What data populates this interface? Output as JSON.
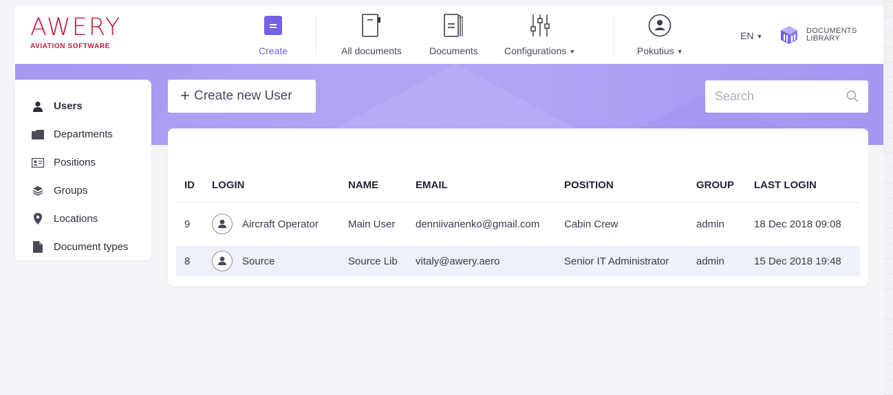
{
  "brand": {
    "logo": "AWERY",
    "tagline": "AVIATION SOFTWARE"
  },
  "nav": {
    "create": "Create",
    "all_documents": "All documents",
    "documents": "Documents",
    "configurations": "Configurations",
    "user": "Pokutius",
    "language": "EN",
    "library_line1": "DOCUMENTS",
    "library_line2": "LIBRARY"
  },
  "sidebar": {
    "items": [
      {
        "label": "Users",
        "icon": "user-icon"
      },
      {
        "label": "Departments",
        "icon": "folder-icon"
      },
      {
        "label": "Positions",
        "icon": "id-card-icon"
      },
      {
        "label": "Groups",
        "icon": "layers-icon"
      },
      {
        "label": "Locations",
        "icon": "map-pin-icon"
      },
      {
        "label": "Document types",
        "icon": "document-icon"
      }
    ]
  },
  "actions": {
    "create_user": "Create new User"
  },
  "search": {
    "placeholder": "Search"
  },
  "table": {
    "headers": {
      "id": "ID",
      "login": "LOGIN",
      "name": "NAME",
      "email": "EMAIL",
      "position": "POSITION",
      "group": "GROUP",
      "last_login": "LAST LOGIN"
    },
    "rows": [
      {
        "id": "9",
        "login": "Aircraft Operator",
        "name": "Main User",
        "email": "denniivanenko@gmail.com",
        "position": "Cabin Crew",
        "group": "admin",
        "last_login": "18 Dec 2018 09:08"
      },
      {
        "id": "8",
        "login": "Source",
        "name": "Source Lib",
        "email": "vitaly@awery.aero",
        "position": "Senior IT Administrator",
        "group": "admin",
        "last_login": "15 Dec 2018 19:48"
      }
    ]
  },
  "colors": {
    "brand_red": "#c8173a",
    "accent_purple": "#7162e6",
    "band_purple": "#ab9cf3"
  }
}
